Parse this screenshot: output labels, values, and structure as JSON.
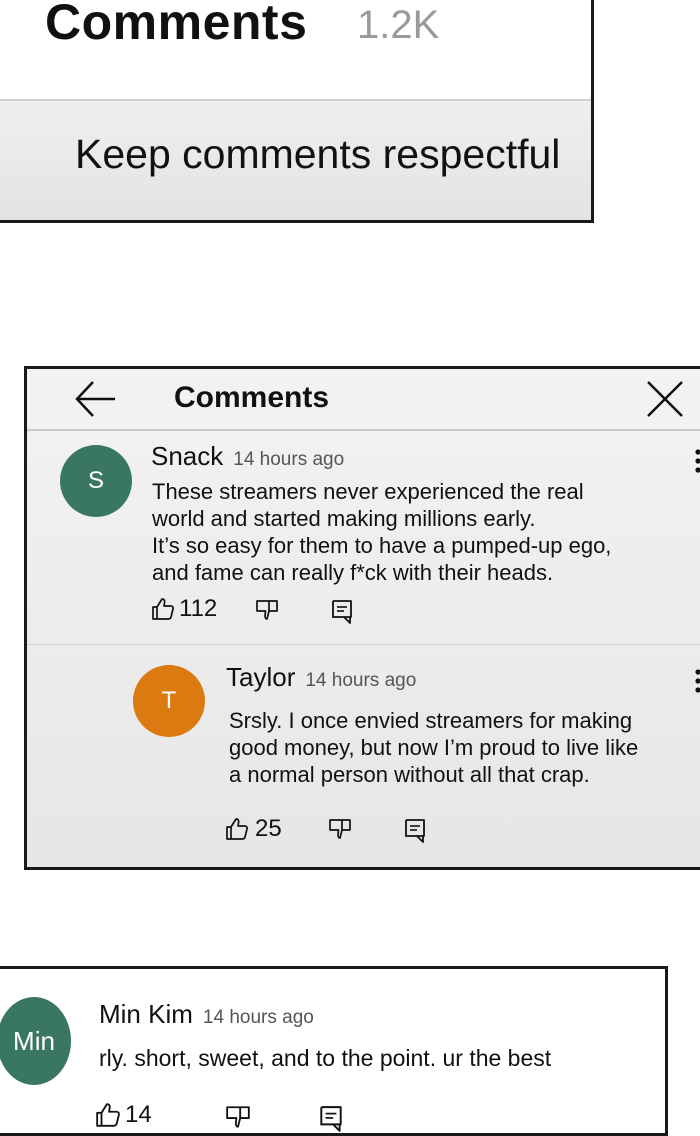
{
  "panel1": {
    "title": "Comments",
    "count": "1.2K",
    "banner": "Keep comments respectful"
  },
  "panel2": {
    "title": "Comments",
    "comments": [
      {
        "avatar_letter": "S",
        "avatar_color": "#3a7763",
        "author": "Snack",
        "time": "14 hours ago",
        "lines": [
          "These streamers never experienced the real",
          "world and started making millions early.",
          "It’s so easy for them to have a pumped-up ego,",
          "and fame can really f*ck with their heads."
        ],
        "likes": "112"
      },
      {
        "avatar_letter": "T",
        "avatar_color": "#db7a10",
        "author": "Taylor",
        "time": "14 hours ago",
        "lines": [
          "Srsly. I once envied streamers for making",
          "good money, but now I’m proud to live like",
          "a normal person without all that crap."
        ],
        "likes": "25"
      }
    ]
  },
  "panel3": {
    "comment": {
      "avatar_letter": "Min",
      "avatar_color": "#3a7763",
      "author": "Min Kim",
      "time": "14 hours ago",
      "lines": [
        "rly. short, sweet, and to the point. ur the best"
      ],
      "likes": "14"
    }
  },
  "icons": {
    "back": "arrow-left-icon",
    "close": "close-icon",
    "like": "thumbs-up-icon",
    "dislike": "thumbs-down-icon",
    "reply": "reply-comment-icon",
    "more": "more-vertical-icon"
  }
}
